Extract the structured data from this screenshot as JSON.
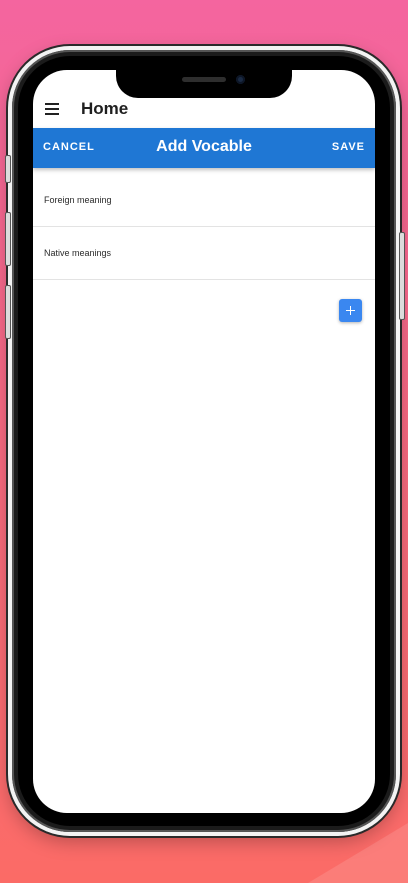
{
  "app_bar": {
    "title": "Home"
  },
  "dialog": {
    "title": "Add Vocable",
    "cancel_label": "CANCEL",
    "save_label": "SAVE"
  },
  "fields": [
    {
      "label": "Foreign meaning"
    },
    {
      "label": "Native meanings"
    }
  ],
  "add_button": {
    "icon": "plus-icon"
  },
  "colors": {
    "accent": "#1f77d4",
    "add_button": "#3a87f0",
    "background_top": "#f4659f",
    "background_bottom": "#fb6b66"
  }
}
